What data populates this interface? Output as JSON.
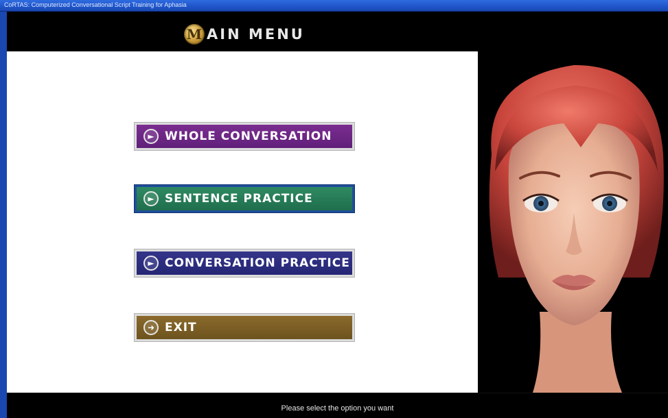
{
  "window": {
    "title": "CoRTAS: Computerized Conversational Script Training for Aphasia"
  },
  "header": {
    "logo_letter": "M",
    "title_rest": "AIN MENU"
  },
  "menu": {
    "buttons": [
      {
        "label": "WHOLE CONVERSATION",
        "icon": "play-circle-icon",
        "color": "#6c2585"
      },
      {
        "label": "SENTENCE PRACTICE",
        "icon": "play-circle-icon",
        "color": "#27805a"
      },
      {
        "label": "CONVERSATION PRACTICE",
        "icon": "play-circle-icon",
        "color": "#2e2e80"
      },
      {
        "label": "EXIT",
        "icon": "exit-circle-icon",
        "color": "#7e6026"
      }
    ]
  },
  "status": {
    "message": "Please select the option you want"
  }
}
